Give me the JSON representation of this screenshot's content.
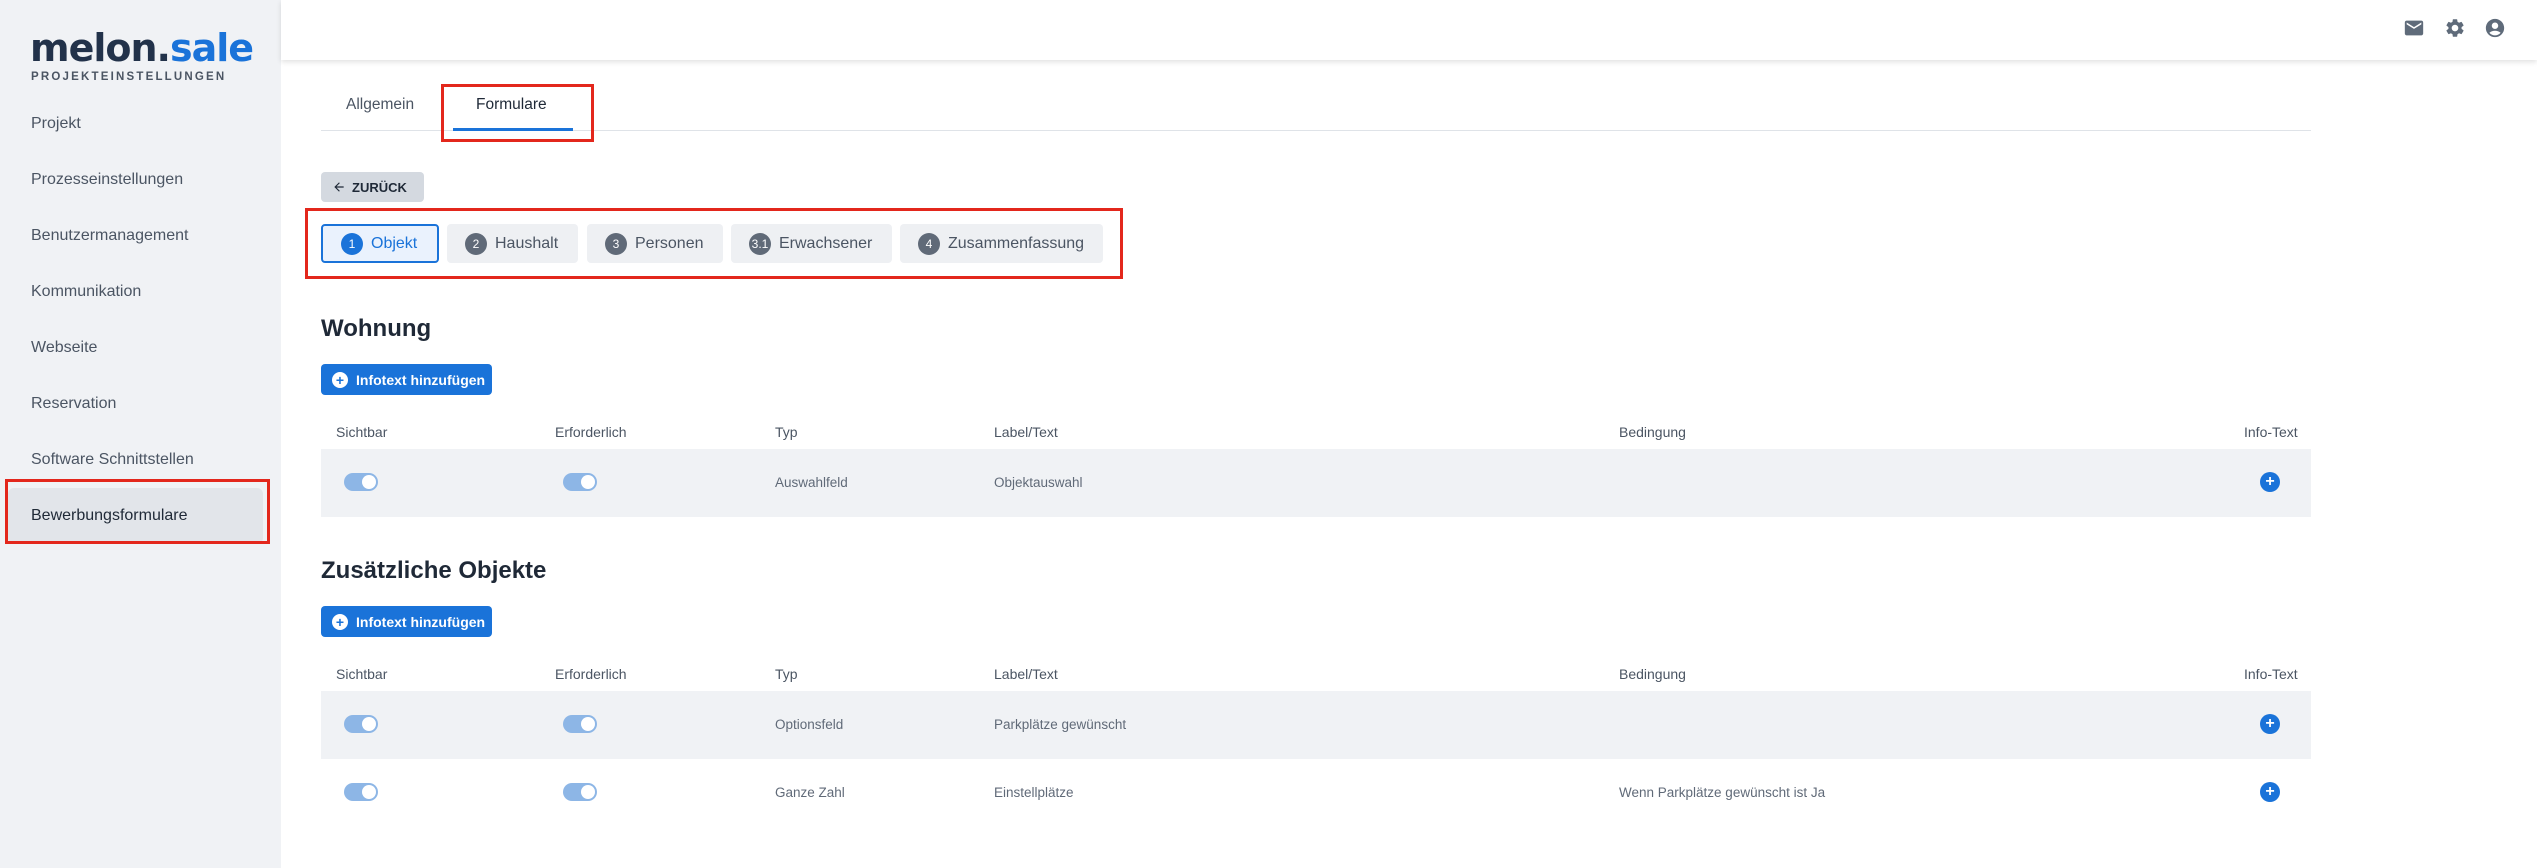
{
  "sidebar": {
    "logo_part1": "melon.",
    "logo_part2": "sale",
    "subtitle": "PROJEKTEINSTELLUNGEN",
    "items": [
      {
        "label": "Projekt"
      },
      {
        "label": "Prozesseinstellungen"
      },
      {
        "label": "Benutzermanagement"
      },
      {
        "label": "Kommunikation"
      },
      {
        "label": "Webseite"
      },
      {
        "label": "Reservation"
      },
      {
        "label": "Software Schnittstellen"
      },
      {
        "label": "Bewerbungsformulare",
        "active": true
      }
    ]
  },
  "topbar": {
    "icons": [
      "mail-icon",
      "gear-icon",
      "account-icon"
    ]
  },
  "tabs": [
    {
      "label": "Allgemein"
    },
    {
      "label": "Formulare",
      "active": true
    }
  ],
  "back_button": {
    "label": "ZURÜCK",
    "icon": "arrow-left-icon"
  },
  "steps": [
    {
      "num": "1",
      "label": "Objekt",
      "active": true
    },
    {
      "num": "2",
      "label": "Haushalt"
    },
    {
      "num": "3",
      "label": "Personen"
    },
    {
      "num": "3.1",
      "label": "Erwachsener"
    },
    {
      "num": "4",
      "label": "Zusammenfassung"
    }
  ],
  "table_headers": {
    "visible": "Sichtbar",
    "required": "Erforderlich",
    "type": "Typ",
    "label": "Label/Text",
    "condition": "Bedingung",
    "info": "Info-Text"
  },
  "sections": [
    {
      "title": "Wohnung",
      "add_button": "Infotext hinzufügen",
      "rows": [
        {
          "type": "Auswahlfeld",
          "label": "Objektauswahl",
          "condition": "",
          "visible": true,
          "required": true
        }
      ]
    },
    {
      "title": "Zusätzliche Objekte",
      "add_button": "Infotext hinzufügen",
      "rows": [
        {
          "type": "Optionsfeld",
          "label": "Parkplätze gewünscht",
          "condition": "",
          "visible": true,
          "required": true
        },
        {
          "type": "Ganze Zahl",
          "label": "Einstellplätze",
          "condition": "Wenn Parkplätze gewünscht ist Ja",
          "visible": true,
          "required": true
        }
      ]
    }
  ],
  "colors": {
    "accent": "#1a73d9",
    "highlight": "#e3271c",
    "sidebar_bg": "#f0f2f5"
  }
}
